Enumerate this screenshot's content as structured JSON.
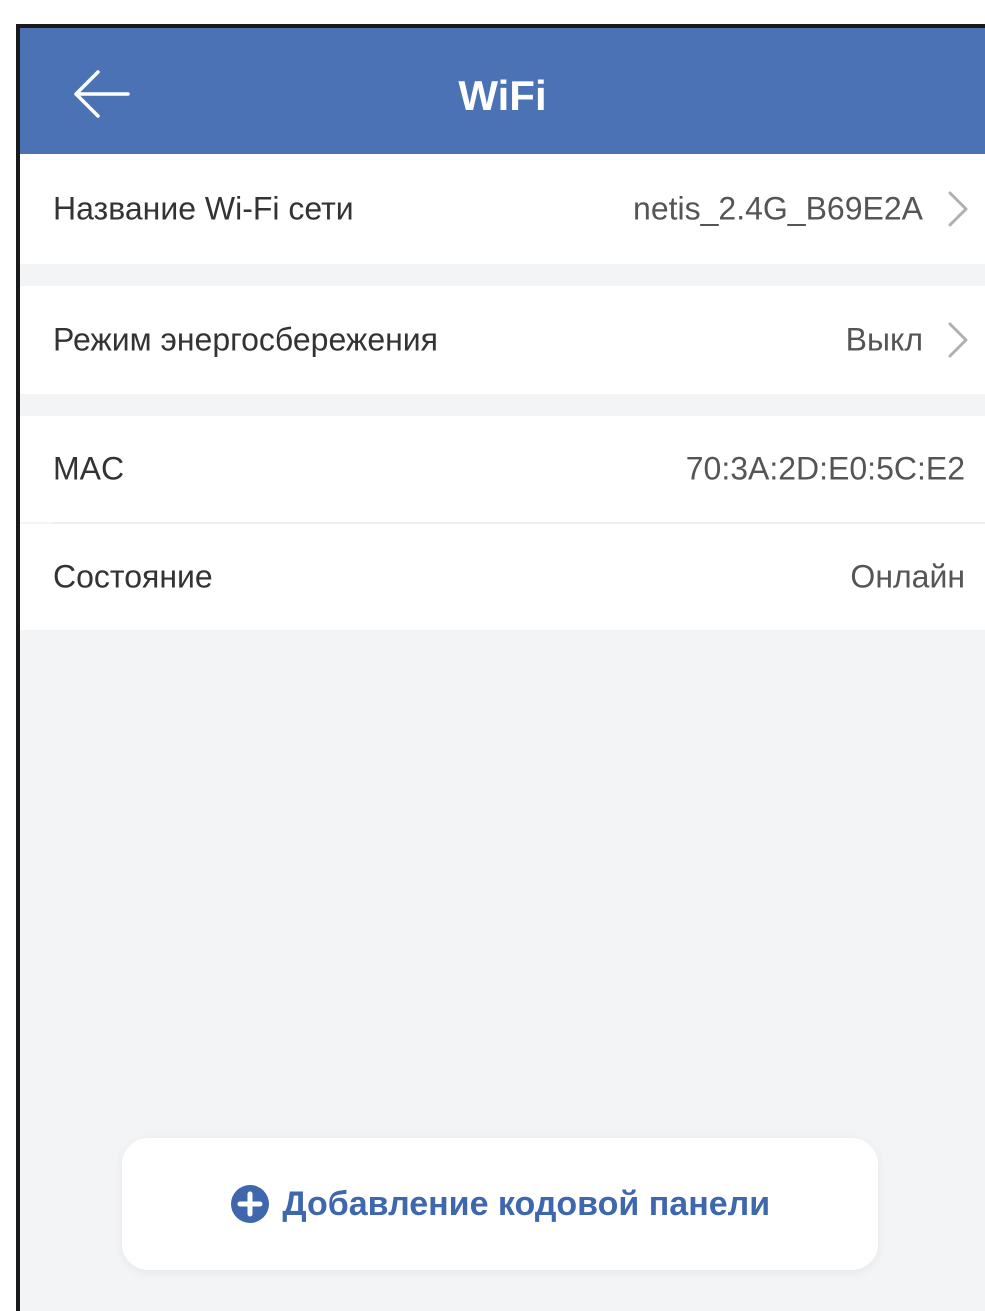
{
  "header": {
    "title": "WiFi",
    "back_icon": "arrow-left-icon",
    "background_color": "#4a72b5"
  },
  "settings": {
    "wifi_name": {
      "label": "Название Wi-Fi сети",
      "value": "netis_2.4G_B69E2A",
      "icon": "chevron-right-icon"
    },
    "power_saving": {
      "label": "Режим энергосбережения",
      "value": "Выкл",
      "icon": "chevron-right-icon"
    },
    "mac": {
      "label": "MAC",
      "value": "70:3A:2D:E0:5C:E2"
    },
    "status": {
      "label": "Состояние",
      "value": "Онлайн"
    }
  },
  "footer": {
    "add_button_label": "Добавление кодовой панели",
    "add_icon": "plus-circle-icon",
    "accent_color": "#3e67ad"
  }
}
